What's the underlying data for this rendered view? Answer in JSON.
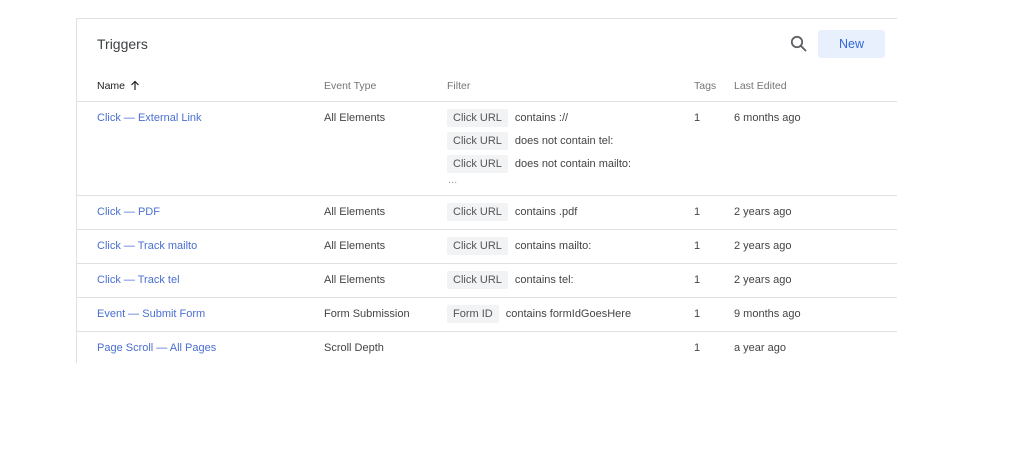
{
  "card": {
    "title": "Triggers",
    "new_button": "New",
    "search_icon": "search-icon"
  },
  "columns": {
    "name": "Name",
    "event_type": "Event Type",
    "filter": "Filter",
    "tags": "Tags",
    "last_edited": "Last Edited",
    "sort_icon": "arrow-up-icon"
  },
  "rows": [
    {
      "name": "Click — External Link",
      "event_type": "All Elements",
      "filters": [
        {
          "variable": "Click URL",
          "condition": "contains ://"
        },
        {
          "variable": "Click URL",
          "condition": "does not contain tel:"
        },
        {
          "variable": "Click URL",
          "condition": "does not contain mailto:"
        }
      ],
      "more": "...",
      "tags": "1",
      "last_edited": "6 months ago"
    },
    {
      "name": "Click — PDF",
      "event_type": "All Elements",
      "filters": [
        {
          "variable": "Click URL",
          "condition": "contains .pdf"
        }
      ],
      "tags": "1",
      "last_edited": "2 years ago"
    },
    {
      "name": "Click — Track mailto",
      "event_type": "All Elements",
      "filters": [
        {
          "variable": "Click URL",
          "condition": "contains mailto:"
        }
      ],
      "tags": "1",
      "last_edited": "2 years ago"
    },
    {
      "name": "Click — Track tel",
      "event_type": "All Elements",
      "filters": [
        {
          "variable": "Click URL",
          "condition": "contains tel:"
        }
      ],
      "tags": "1",
      "last_edited": "2 years ago"
    },
    {
      "name": "Event — Submit Form",
      "event_type": "Form Submission",
      "filters": [
        {
          "variable": "Form ID",
          "condition": "contains formIdGoesHere"
        }
      ],
      "tags": "1",
      "last_edited": "9 months ago"
    },
    {
      "name": "Page Scroll — All Pages",
      "event_type": "Scroll Depth",
      "filters": [],
      "tags": "1",
      "last_edited": "a year ago"
    }
  ]
}
